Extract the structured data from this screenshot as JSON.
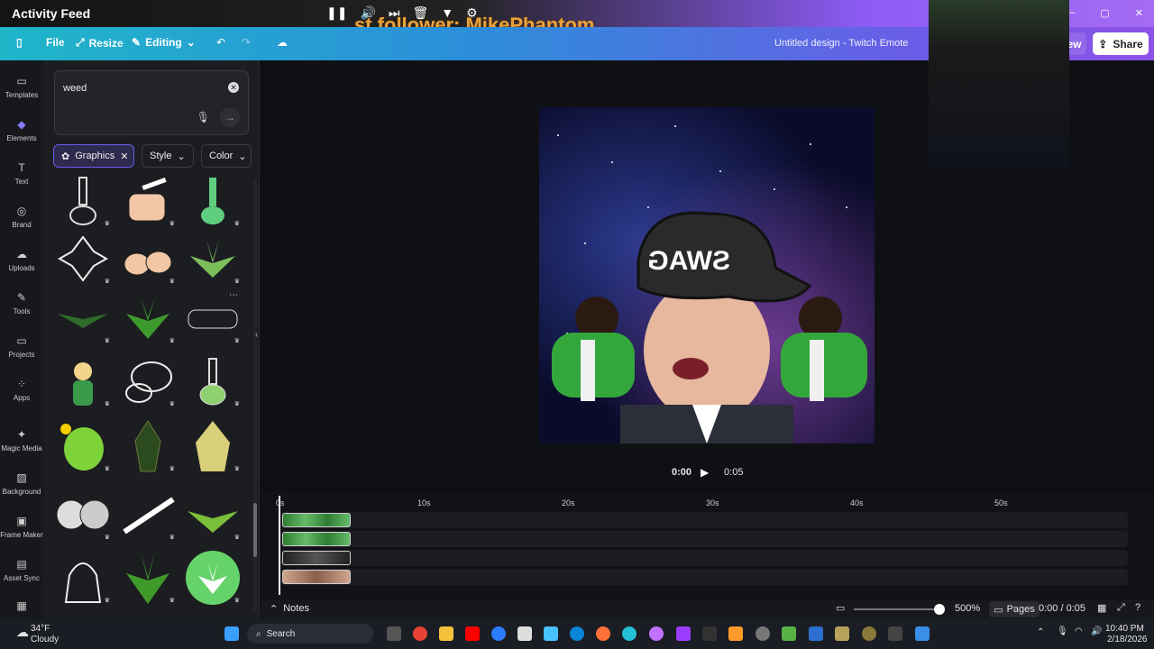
{
  "overlay": {
    "title": "Activity Feed",
    "follower_text": "st follower: MikePhantom",
    "window_controls": [
      "–",
      "▢",
      "✕"
    ]
  },
  "toolbar": {
    "file": "File",
    "resize": "Resize",
    "editing": "Editing",
    "design_name": "Untitled design - Twitch Emote",
    "preview": "Preview",
    "share": "Share"
  },
  "rail": {
    "items": [
      {
        "label": "Templates",
        "icon": "template-icon"
      },
      {
        "label": "Elements",
        "icon": "elements-icon"
      },
      {
        "label": "Text",
        "icon": "text-icon"
      },
      {
        "label": "Brand",
        "icon": "brand-icon"
      },
      {
        "label": "Uploads",
        "icon": "upload-icon"
      },
      {
        "label": "Tools",
        "icon": "tools-icon"
      },
      {
        "label": "Projects",
        "icon": "folder-icon"
      },
      {
        "label": "Apps",
        "icon": "apps-icon"
      },
      {
        "label": "Magic Media",
        "icon": "magic-icon"
      },
      {
        "label": "Background",
        "icon": "background-icon"
      },
      {
        "label": "Frame Maker",
        "icon": "frame-icon"
      },
      {
        "label": "Asset Sync",
        "icon": "sync-icon"
      }
    ]
  },
  "panel": {
    "search_value": "weed",
    "chips": {
      "graphics": "Graphics",
      "style": "Style",
      "color": "Color"
    }
  },
  "playback": {
    "current": "0:00",
    "duration": "0:05"
  },
  "timeline": {
    "ticks": [
      "0s",
      "10s",
      "20s",
      "30s",
      "40s",
      "50s"
    ]
  },
  "status": {
    "notes": "Notes",
    "zoom": "500%",
    "pages": "Pages",
    "time": "0:00 / 0:05",
    "zoom_level": 0.95
  },
  "taskbar": {
    "weather_temp": "34°F",
    "weather_desc": "Cloudy",
    "search": "Search",
    "clock_time": "10:40 PM",
    "clock_date": "2/18/2026"
  },
  "colors": {
    "accent": "#8b7cf7",
    "toolbar_start": "#1fb6c9",
    "toolbar_end": "#8d52e6"
  }
}
